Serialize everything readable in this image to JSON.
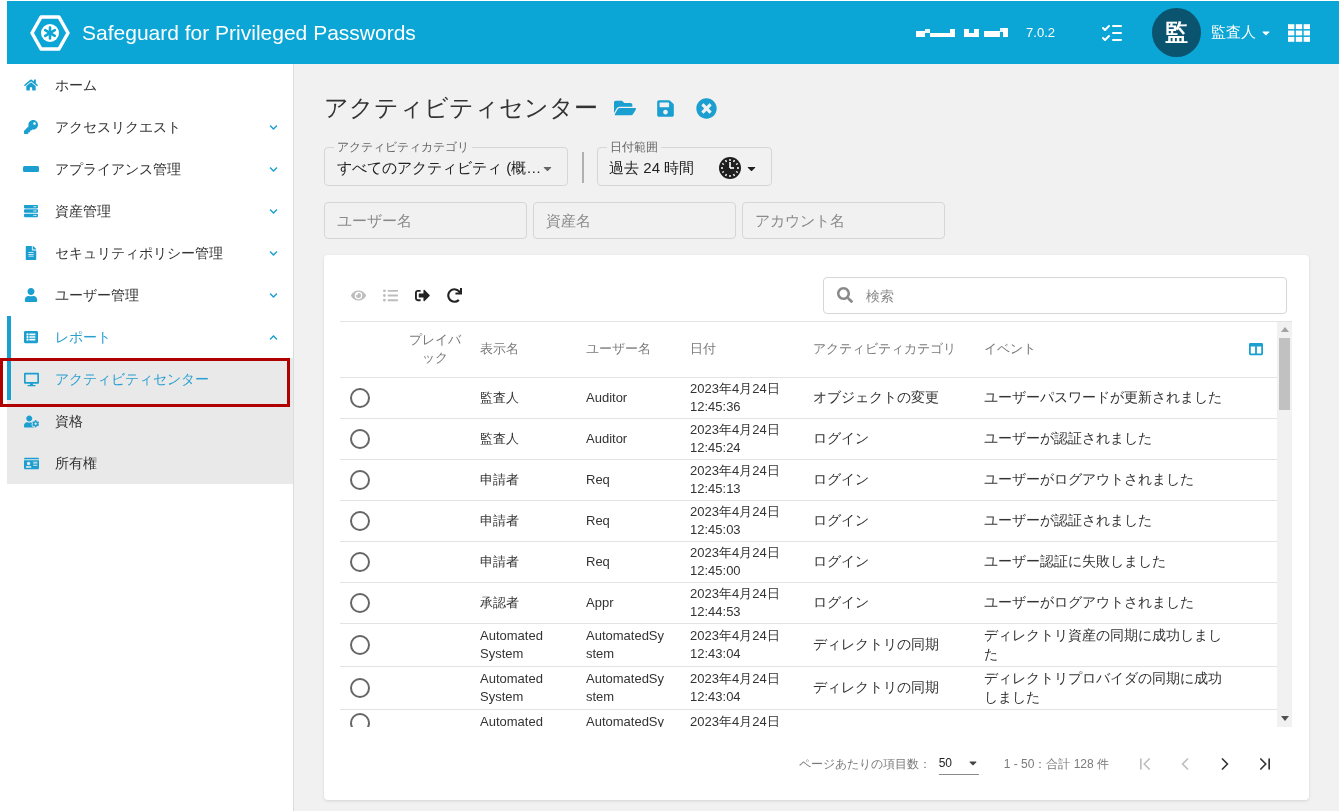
{
  "header": {
    "title": "Safeguard for Privileged Passwords",
    "version": "7.0.2",
    "avatar": "監",
    "user": "監査人"
  },
  "sidebar": {
    "items": [
      {
        "label": "ホーム",
        "kind": "link",
        "selected": false
      },
      {
        "label": "アクセスリクエスト",
        "kind": "group",
        "expanded": false,
        "selected": false
      },
      {
        "label": "アプライアンス管理",
        "kind": "group",
        "expanded": false,
        "selected": false
      },
      {
        "label": "資産管理",
        "kind": "group",
        "expanded": false,
        "selected": false
      },
      {
        "label": "セキュリティポリシー管理",
        "kind": "group",
        "expanded": false,
        "selected": false
      },
      {
        "label": "ユーザー管理",
        "kind": "group",
        "expanded": false,
        "selected": false
      },
      {
        "label": "レポート",
        "kind": "group",
        "expanded": true,
        "selected": true,
        "children": [
          {
            "label": "アクティビティセンター",
            "selected": true,
            "annotated": true
          },
          {
            "label": "資格",
            "selected": false,
            "annotated": false
          },
          {
            "label": "所有権",
            "selected": false,
            "annotated": false
          }
        ]
      }
    ]
  },
  "page": {
    "title": "アクティビティセンター"
  },
  "filters": {
    "category": {
      "label": "アクティビティカテゴリ",
      "value": "すべてのアクティビティ (概…"
    },
    "date_range": {
      "label": "日付範囲",
      "value": "過去 24 時間"
    },
    "fields": [
      {
        "placeholder": "ユーザー名"
      },
      {
        "placeholder": "資産名"
      },
      {
        "placeholder": "アカウント名"
      }
    ]
  },
  "table": {
    "toolbar": [
      {
        "kind": "view",
        "disabled": true
      },
      {
        "kind": "details",
        "disabled": true
      },
      {
        "kind": "export",
        "disabled": false
      },
      {
        "kind": "refresh",
        "disabled": false
      }
    ],
    "search": {
      "placeholder": "検索"
    },
    "columns": [
      {
        "label": "プレイバック"
      },
      {
        "label": "表示名"
      },
      {
        "label": "ユーザー名"
      },
      {
        "label": "日付"
      },
      {
        "label": "アクティビティカテゴリ"
      },
      {
        "label": "イベント"
      }
    ],
    "rows": [
      {
        "kind": "full",
        "selected": false,
        "display_name": "監査人",
        "user_name": "Auditor",
        "date": "2023年4月24日",
        "time": "12:45:36",
        "category": "オブジェクトの変更",
        "event": "ユーザーパスワードが更新されました"
      },
      {
        "kind": "full",
        "selected": false,
        "display_name": "監査人",
        "user_name": "Auditor",
        "date": "2023年4月24日",
        "time": "12:45:24",
        "category": "ログイン",
        "event": "ユーザーが認証されました"
      },
      {
        "kind": "full",
        "selected": false,
        "display_name": "申請者",
        "user_name": "Req",
        "date": "2023年4月24日",
        "time": "12:45:13",
        "category": "ログイン",
        "event": "ユーザーがログアウトされました"
      },
      {
        "kind": "full",
        "selected": false,
        "display_name": "申請者",
        "user_name": "Req",
        "date": "2023年4月24日",
        "time": "12:45:03",
        "category": "ログイン",
        "event": "ユーザーが認証されました"
      },
      {
        "kind": "full",
        "selected": false,
        "display_name": "申請者",
        "user_name": "Req",
        "date": "2023年4月24日",
        "time": "12:45:00",
        "category": "ログイン",
        "event": "ユーザー認証に失敗しました"
      },
      {
        "kind": "full",
        "selected": false,
        "display_name": "承認者",
        "user_name": "Appr",
        "date": "2023年4月24日",
        "time": "12:44:53",
        "category": "ログイン",
        "event": "ユーザーがログアウトされました"
      },
      {
        "kind": "full",
        "selected": false,
        "display_name": "Automated System",
        "user_name": "AutomatedSystem",
        "date": "2023年4月24日",
        "time": "12:43:04",
        "category": "ディレクトリの同期",
        "event": "ディレクトリ資産の同期に成功しました"
      },
      {
        "kind": "full",
        "selected": false,
        "display_name": "Automated System",
        "user_name": "AutomatedSystem",
        "date": "2023年4月24日",
        "time": "12:43:04",
        "category": "ディレクトリの同期",
        "event": "ディレクトリプロバイダの同期に成功しました"
      },
      {
        "kind": "clipped",
        "selected": false,
        "display_name": "Automated",
        "user_name": "AutomatedSy",
        "date": "2023年4月24日"
      }
    ]
  },
  "pagination": {
    "page_size_label": "ページあたりの項目数：",
    "page_size": "50",
    "range": "1 - 50：合計 128 件",
    "buttons": [
      {
        "kind": "first",
        "disabled": true
      },
      {
        "kind": "prev",
        "disabled": true
      },
      {
        "kind": "next",
        "disabled": false
      },
      {
        "kind": "last",
        "disabled": false
      }
    ]
  }
}
